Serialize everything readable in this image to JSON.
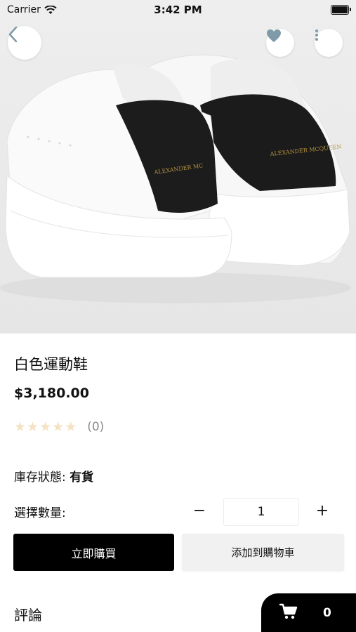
{
  "status_bar": {
    "carrier": "Carrier",
    "time": "3:42 PM"
  },
  "product": {
    "image_brand_text": "ALEXANDER MCQUEEN",
    "title": "白色運動鞋",
    "price": "$3,180.00",
    "rating": {
      "stars": 0,
      "max_stars": 5,
      "count_label": "(0)"
    },
    "stock_label": "庫存狀態:",
    "stock_value": "有貨"
  },
  "quantity": {
    "label": "選擇數量:",
    "minus": "−",
    "value": "1",
    "plus": "+"
  },
  "actions": {
    "buy_now": "立即購買",
    "add_to_cart": "添加到購物車"
  },
  "reviews": {
    "heading": "評論"
  },
  "cart": {
    "count": "0"
  },
  "icons": {
    "back": "chevron-left-icon",
    "favorite": "heart-icon",
    "more": "more-vertical-icon",
    "cart": "shopping-cart-icon"
  },
  "colors": {
    "primary": "#000000",
    "star_empty": "#f5e2c2",
    "fav_icon": "#7f9aa8"
  }
}
